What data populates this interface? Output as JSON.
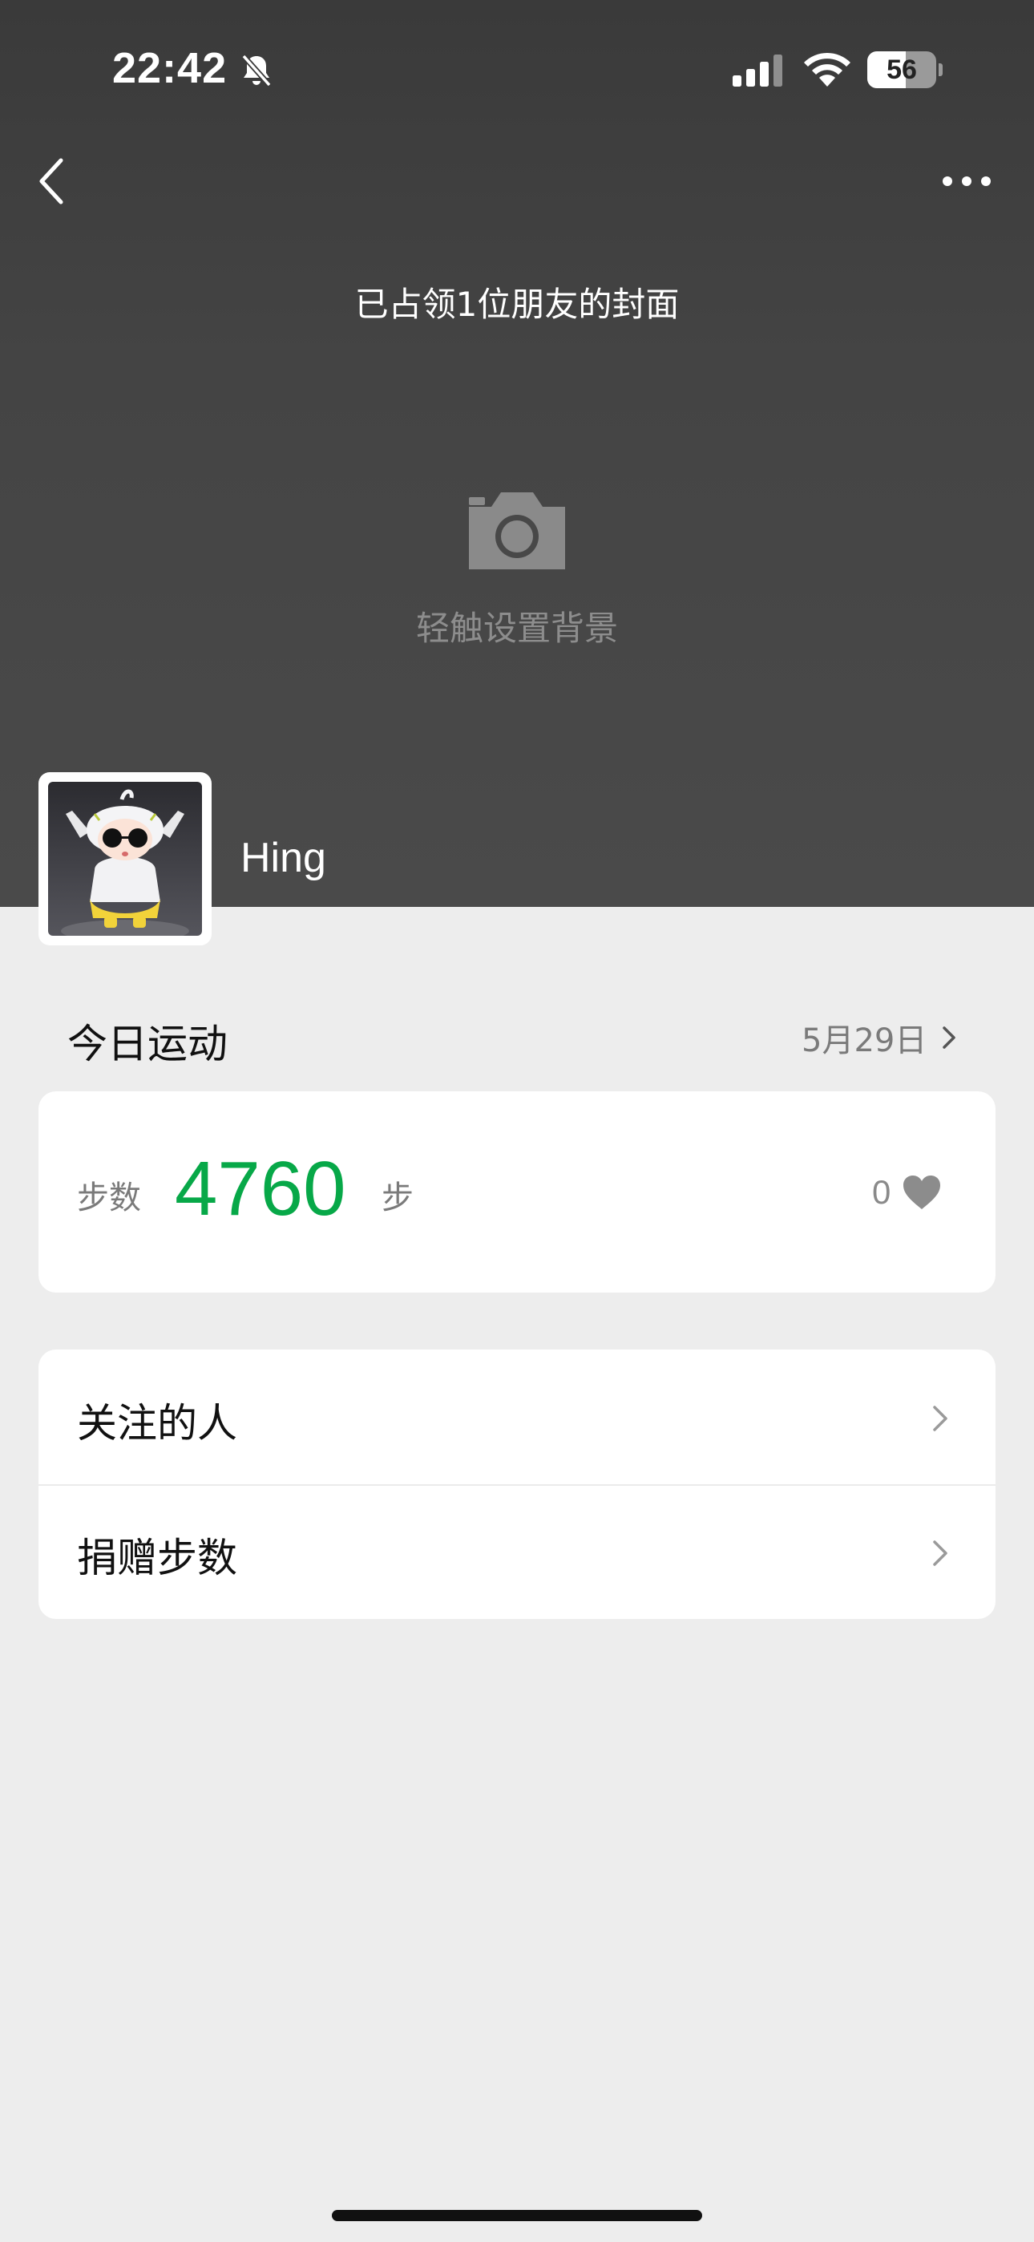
{
  "status_bar": {
    "time": "22:42",
    "battery_level": "56"
  },
  "cover": {
    "caption": "已占领1位朋友的封面",
    "set_background_label": "轻触设置背景"
  },
  "profile": {
    "username": "Hing"
  },
  "today": {
    "title": "今日运动",
    "date": "5月29日",
    "steps_label": "步数",
    "steps_value": "4760",
    "steps_unit": "步",
    "likes_count": "0"
  },
  "menu": {
    "items": [
      {
        "label": "关注的人"
      },
      {
        "label": "捐赠步数"
      }
    ]
  },
  "colors": {
    "accent_green": "#07a848",
    "cover_bg": "#444444",
    "page_bg": "#ededed"
  }
}
